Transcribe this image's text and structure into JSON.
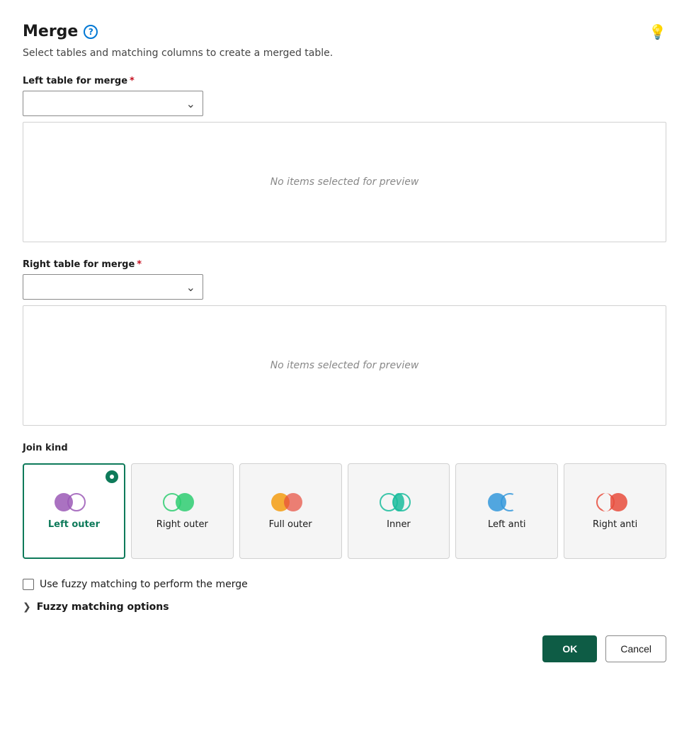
{
  "header": {
    "title": "Merge",
    "subtitle": "Select tables and matching columns to create a merged table."
  },
  "left_table": {
    "label": "Left table for merge",
    "required": true,
    "placeholder": "",
    "preview_empty": "No items selected for preview"
  },
  "right_table": {
    "label": "Right table for merge",
    "required": true,
    "placeholder": "",
    "preview_empty": "No items selected for preview"
  },
  "join_kind": {
    "label": "Join kind",
    "options": [
      {
        "id": "left_outer",
        "label": "Left outer",
        "selected": true
      },
      {
        "id": "right_outer",
        "label": "Right outer",
        "selected": false
      },
      {
        "id": "full_outer",
        "label": "Full outer",
        "selected": false
      },
      {
        "id": "inner",
        "label": "Inner",
        "selected": false
      },
      {
        "id": "left_anti",
        "label": "Left anti",
        "selected": false
      },
      {
        "id": "right_anti",
        "label": "Right anti",
        "selected": false
      }
    ]
  },
  "fuzzy": {
    "checkbox_label": "Use fuzzy matching to perform the merge",
    "options_label": "Fuzzy matching options"
  },
  "buttons": {
    "ok": "OK",
    "cancel": "Cancel"
  }
}
